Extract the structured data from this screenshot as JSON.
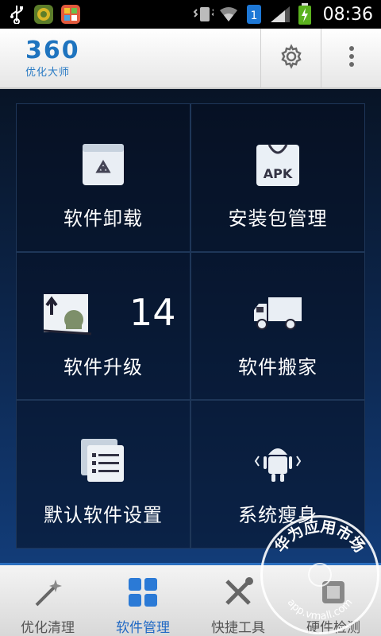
{
  "status_bar": {
    "time": "08:36",
    "icons": [
      "usb-icon",
      "app-icon",
      "gallery-icon",
      "vibrate-icon",
      "wifi-icon",
      "sim-icon",
      "signal-icon",
      "battery-icon"
    ]
  },
  "header": {
    "brand_number": "360",
    "brand_subtitle": "优化大师",
    "settings_icon": "gear-icon",
    "more_icon": "more-vertical-icon"
  },
  "tiles": [
    {
      "label": "软件卸载",
      "icon": "recycle-bin-icon"
    },
    {
      "label": "安装包管理",
      "icon": "apk-package-icon"
    },
    {
      "label": "软件升级",
      "icon": "upgrade-android-icon",
      "count": "14"
    },
    {
      "label": "软件搬家",
      "icon": "truck-icon"
    },
    {
      "label": "默认软件设置",
      "icon": "list-document-icon"
    },
    {
      "label": "系统瘦身",
      "icon": "android-slim-icon"
    }
  ],
  "tabs": [
    {
      "label": "优化清理",
      "icon": "magic-wand-icon",
      "active": false
    },
    {
      "label": "软件管理",
      "icon": "grid-apps-icon",
      "active": true
    },
    {
      "label": "快捷工具",
      "icon": "tools-icon",
      "active": false
    },
    {
      "label": "硬件检测",
      "icon": "hardware-icon",
      "active": false
    }
  ],
  "watermark": {
    "text": "华为应用市场",
    "url": "app.vmall.com"
  },
  "colors": {
    "accent": "#2169c4",
    "brand": "#1f74bf",
    "main_bg": "#0c2448"
  }
}
